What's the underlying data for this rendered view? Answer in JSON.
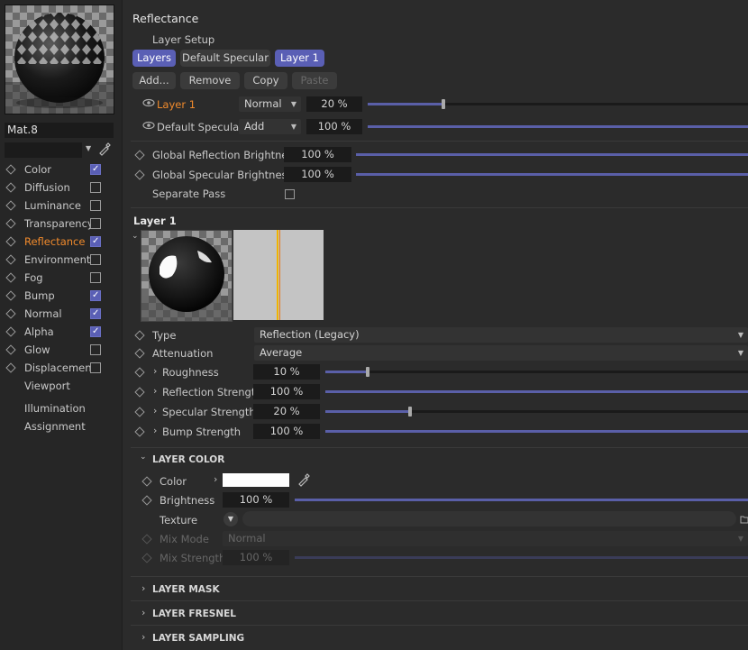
{
  "material": {
    "name": "Mat.8"
  },
  "channels": [
    {
      "label": "Color",
      "checked": true,
      "checkbox": true
    },
    {
      "label": "Diffusion",
      "checked": false,
      "checkbox": true
    },
    {
      "label": "Luminance",
      "checked": false,
      "checkbox": true
    },
    {
      "label": "Transparency",
      "checked": false,
      "checkbox": true
    },
    {
      "label": "Reflectance",
      "checked": true,
      "checkbox": true,
      "active": true
    },
    {
      "label": "Environment",
      "checked": false,
      "checkbox": true
    },
    {
      "label": "Fog",
      "checked": false,
      "checkbox": true
    },
    {
      "label": "Bump",
      "checked": true,
      "checkbox": true
    },
    {
      "label": "Normal",
      "checked": true,
      "checkbox": true
    },
    {
      "label": "Alpha",
      "checked": true,
      "checkbox": true
    },
    {
      "label": "Glow",
      "checked": false,
      "checkbox": true
    },
    {
      "label": "Displacement",
      "checked": false,
      "checkbox": true
    },
    {
      "label": "Viewport",
      "checkbox": false,
      "no_diamond": true
    },
    {
      "label": "Illumination",
      "checkbox": false,
      "no_diamond": true
    },
    {
      "label": "Assignment",
      "checkbox": false,
      "no_diamond": true
    }
  ],
  "reflectance": {
    "title": "Reflectance",
    "layer_setup": "Layer Setup",
    "tabs": [
      "Layers",
      "Default Specular",
      "Layer 1"
    ],
    "actions": [
      "Add...",
      "Remove",
      "Copy",
      "Paste"
    ],
    "layers": [
      {
        "name": "Layer 1",
        "mode": "Normal",
        "amount": "20 %",
        "fraction": 0.2
      },
      {
        "name": "Default Specular",
        "mode": "Add",
        "amount": "100 %",
        "fraction": 1.0
      }
    ],
    "global_reflection_label": "Global Reflection Brightness",
    "global_reflection_value": "100 %",
    "global_specular_label": "Global Specular Brightness",
    "global_specular_value": "100 %",
    "separate_pass_label": "Separate Pass"
  },
  "layer1": {
    "title": "Layer 1",
    "type_label": "Type",
    "type_value": "Reflection (Legacy)",
    "attenuation_label": "Attenuation",
    "attenuation_value": "Average",
    "roughness_label": "Roughness",
    "roughness_value": "10 %",
    "roughness_fraction": 0.1,
    "reflection_strength_label": "Reflection Strength",
    "reflection_strength_value": "100 %",
    "specular_strength_label": "Specular Strength",
    "specular_strength_value": "20 %",
    "specular_strength_fraction": 0.2,
    "bump_strength_label": "Bump Strength",
    "bump_strength_value": "100 %"
  },
  "layer_color": {
    "header": "LAYER COLOR",
    "color_label": "Color",
    "color_swatch": "#ffffff",
    "brightness_label": "Brightness",
    "brightness_value": "100 %",
    "texture_label": "Texture",
    "mix_mode_label": "Mix Mode",
    "mix_mode_value": "Normal",
    "mix_strength_label": "Mix Strength",
    "mix_strength_value": "100 %"
  },
  "sections": [
    "LAYER MASK",
    "LAYER FRESNEL",
    "LAYER SAMPLING"
  ],
  "colors": {
    "accent": "#5a5fb5",
    "active_text": "#f08a2c",
    "background": "#2b2b2b"
  }
}
